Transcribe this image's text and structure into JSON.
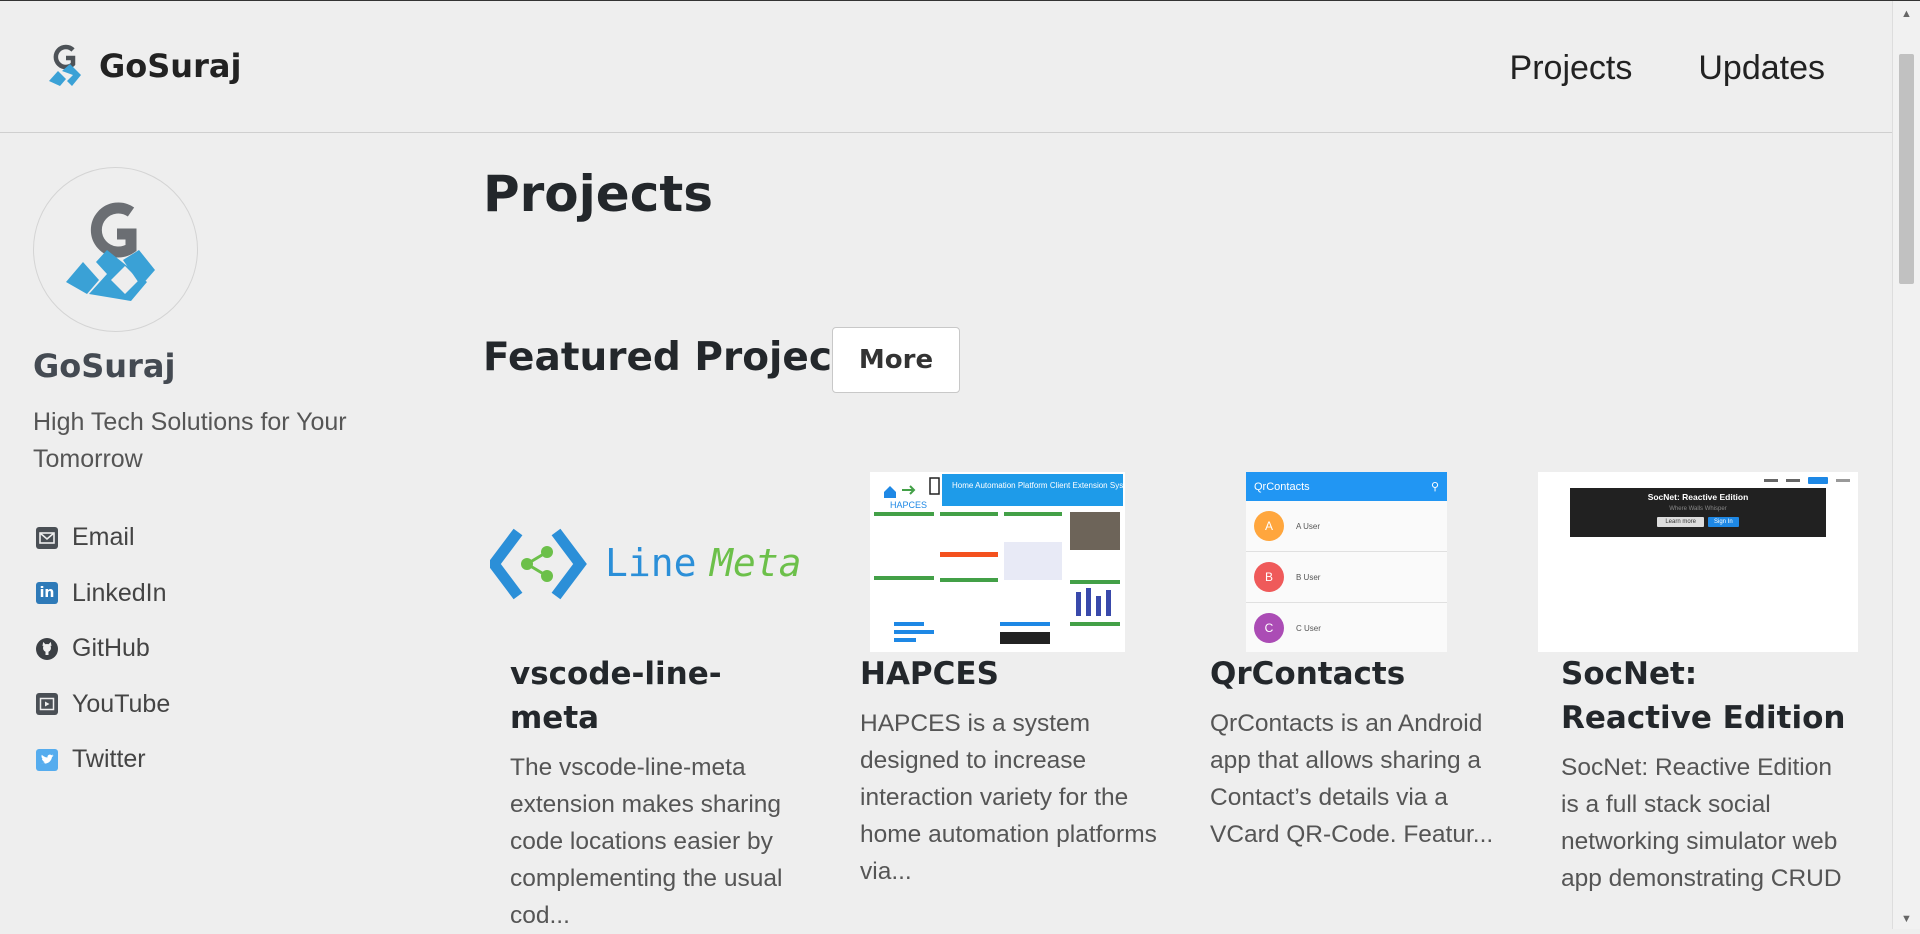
{
  "header": {
    "brand": "GoSuraj",
    "nav": [
      "Projects",
      "Updates"
    ]
  },
  "sidebar": {
    "name": "GoSuraj",
    "tagline": "High Tech Solutions for Your Tomorrow",
    "links": [
      {
        "label": "Email",
        "icon": "email-icon"
      },
      {
        "label": "LinkedIn",
        "icon": "linkedin-icon"
      },
      {
        "label": "GitHub",
        "icon": "github-icon"
      },
      {
        "label": "YouTube",
        "icon": "youtube-icon"
      },
      {
        "label": "Twitter",
        "icon": "twitter-icon"
      }
    ]
  },
  "main": {
    "title": "Projects",
    "featured_title": "Featured Projects",
    "more_label": "More",
    "cards": [
      {
        "title": "vscode-line-meta",
        "description": "The vscode-line-meta extension makes sharing code locations easier by complementing the usual cod...",
        "thumb": {
          "text_a": "Line",
          "text_b": "Meta"
        }
      },
      {
        "title": "HAPCES",
        "description": "HAPCES is a system designed to increase interaction variety for the home automation platforms via...",
        "thumb": {
          "banner": "Home Automation Platform Client Extension System",
          "logo": "HAPCES"
        }
      },
      {
        "title": "QrContacts",
        "description": "QrContacts is an Android app that allows sharing a Contact’s details via a VCard QR-Code. Featur...",
        "thumb": {
          "app_title": "QrContacts",
          "contacts": [
            {
              "initial": "A",
              "name": "A User"
            },
            {
              "initial": "B",
              "name": "B User"
            },
            {
              "initial": "C",
              "name": "C User"
            }
          ]
        }
      },
      {
        "title": "SocNet: Reactive Edition",
        "description": "SocNet: Reactive Edition is a full stack social networking simulator web app demonstrating CRUD",
        "thumb": {
          "hero_title": "SocNet: Reactive Edition",
          "hero_sub": "Where Walls Whisper",
          "btn_learn": "Learn more",
          "btn_sign": "Sign In"
        }
      }
    ]
  },
  "colors": {
    "brand_blue": "#3aa1d6",
    "brand_gray": "#6b6e73",
    "linemeta_blue": "#2b8fd8",
    "linemeta_green": "#6cc04a",
    "qr_blue": "#2196f3"
  }
}
